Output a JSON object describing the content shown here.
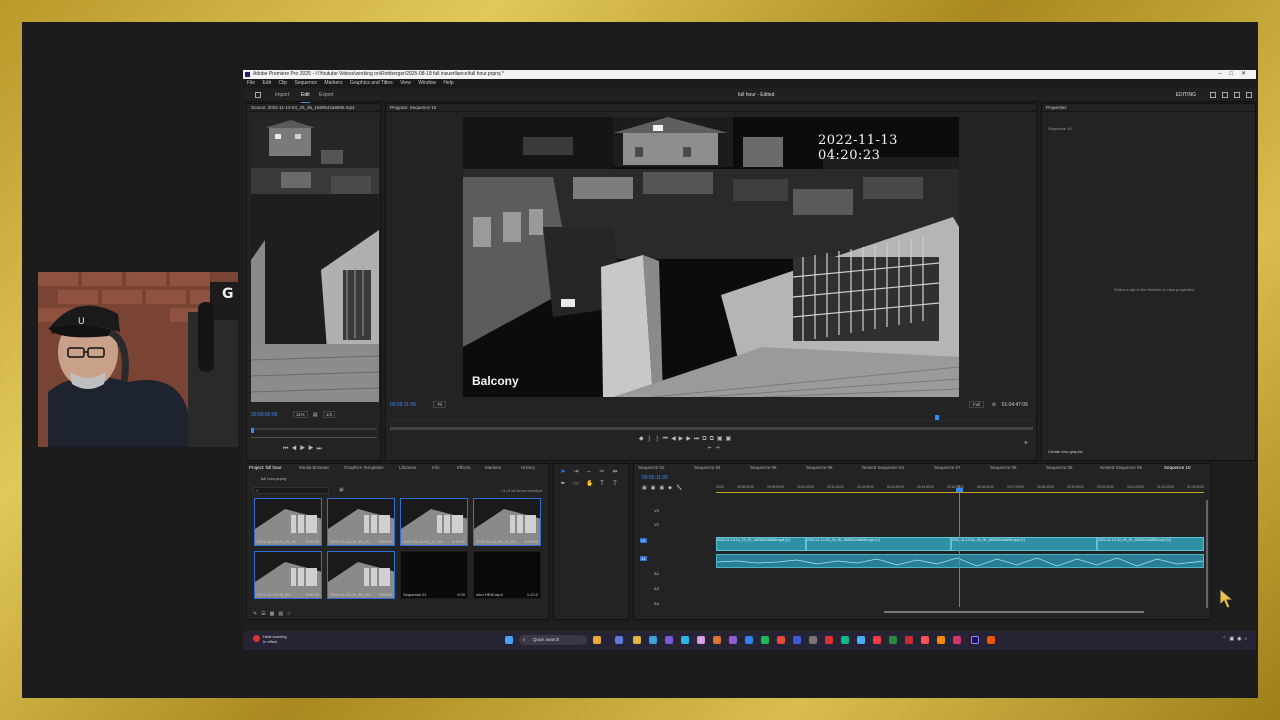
{
  "window": {
    "title": "Adobe Premiere Pro 2025 - I:\\Youtube Videos\\working on\\Rohberger\\2025-08-18 full insuerllance\\full hour.prproj *",
    "center_title": "full hour - Edited",
    "workspace": "EDITING"
  },
  "menu": [
    "File",
    "Edit",
    "Clip",
    "Sequence",
    "Markers",
    "Graphics and Titles",
    "View",
    "Window",
    "Help"
  ],
  "workspace_tabs": [
    "Import",
    "Edit",
    "Export"
  ],
  "source_monitor": {
    "title": "Source: 2022-11-13-04_25_36_1669542a6808.mp4",
    "timecode": "00:00:00:00",
    "zoom": "11%",
    "quality": "1/2"
  },
  "program_monitor": {
    "title": "Program: Sequence 10",
    "timestamp": "2022-11-13  04:20:23",
    "overlay": "Balcony",
    "timecode": "00:55:11:05",
    "fit": "Fit",
    "quality": "Full",
    "duration": "01:04:47:05"
  },
  "properties": {
    "title": "Properties",
    "sequence": "Sequence 10",
    "hint": "Select a clip in the timeline to view properties.",
    "create_graphic": "Create new graphic"
  },
  "project_panel": {
    "tabs": [
      "Project: full hour",
      "Media Browser",
      "Graphics Templates",
      "Libraries",
      "Info",
      "Effects",
      "Markers",
      "History"
    ],
    "file": "full hour.prproj",
    "count": "13 of 16 items selected",
    "items": [
      {
        "label": "2022-11-13-04_39_00...",
        "dur": "5:00:00"
      },
      {
        "label": "2022-11-13-04_39_00...",
        "dur": "5:00:00"
      },
      {
        "label": "2022-11-13-04_19_00...",
        "dur": "4:19:11"
      },
      {
        "label": "2022-11-13-04_19_00...",
        "dur": "5:00:00"
      },
      {
        "label": "2022-11-13-04_50...",
        "dur": "5:00:00"
      },
      {
        "label": "2022-11-13-04_39_00...",
        "dur": "5:00:00"
      },
      {
        "label": "Sequence 01",
        "dur": "0:00"
      },
      {
        "label": "intro HEM.mp4",
        "dur": "1:12:0"
      }
    ]
  },
  "timeline": {
    "tabs": [
      "Sequence 02",
      "Sequence 04",
      "Sequence 06",
      "Sequence 06",
      "Nested Sequence 04",
      "Sequence 07",
      "Sequence 08",
      "Sequence 05",
      "Nested Sequence 05",
      "Sequence 10"
    ],
    "timecode": "00:55:11:05",
    "ruler": [
      "00:00",
      "00:08:00:00",
      "00:09:00:00",
      "00:10:00:00",
      "00:11:00:00",
      "00:12:00:00",
      "00:13:00:00",
      "00:14:00:00",
      "00:15:00:00",
      "00:16:00:00",
      "00:17:00:00",
      "00:18:00:00",
      "00:19:00:00",
      "00:20:00:00",
      "00:21:00:00",
      "01:02:00:00",
      "01:03:00:00"
    ],
    "tracks": [
      "V3",
      "V2",
      "V1",
      "A1",
      "A2",
      "A3",
      "A4"
    ],
    "clips": [
      "2022-11-13-04_19_00_1669542a6808.mp4 [V]",
      "2022-11-13-04_29_00_1669542a6808.mp4 [V]",
      "2022-11-13-04_39_00_1669542a6808.mp4 [V]",
      "2022-11-13-04_49_00_1669542a6808.mp4 [V]"
    ]
  },
  "taskbar": {
    "notification_title": "Heat warning",
    "notification_sub": "In effect",
    "search": "Quick search"
  },
  "colors": {
    "accent": "#2d8cff",
    "clip": "#2f90a5",
    "frame_gold": "#d0b040"
  }
}
